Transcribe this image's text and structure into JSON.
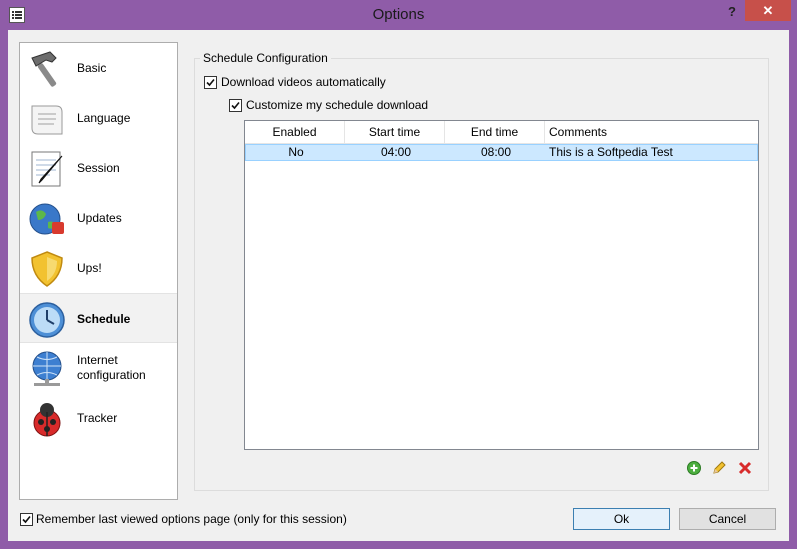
{
  "window": {
    "title": "Options",
    "help_label": "?",
    "close_label": "✕"
  },
  "nav": {
    "items": [
      {
        "label": "Basic",
        "icon": "hammer-icon"
      },
      {
        "label": "Language",
        "icon": "scroll-icon"
      },
      {
        "label": "Session",
        "icon": "notepad-pen-icon"
      },
      {
        "label": "Updates",
        "icon": "globe-update-icon"
      },
      {
        "label": "Ups!",
        "icon": "shield-icon"
      },
      {
        "label": "Schedule",
        "icon": "clock-icon",
        "selected": true
      },
      {
        "label": "Internet configuration",
        "label_line1": "Internet",
        "label_line2": "configuration",
        "icon": "network-globe-icon"
      },
      {
        "label": "Tracker",
        "icon": "ladybug-icon"
      }
    ]
  },
  "schedule": {
    "group_title": "Schedule Configuration",
    "download_auto_label": "Download videos automatically",
    "download_auto_checked": true,
    "customize_label": "Customize my schedule download",
    "customize_checked": true,
    "columns": [
      "Enabled",
      "Start time",
      "End time",
      "Comments"
    ],
    "rows": [
      {
        "enabled": "No",
        "start": "04:00",
        "end": "08:00",
        "comments": "This is a Softpedia Test"
      }
    ]
  },
  "footer": {
    "remember_label": "Remember last viewed options page (only for this session)",
    "remember_checked": true,
    "ok_label": "Ok",
    "cancel_label": "Cancel"
  },
  "colors": {
    "frame": "#8f5ca8",
    "close": "#c7504a",
    "selection": "#cce8ff"
  }
}
